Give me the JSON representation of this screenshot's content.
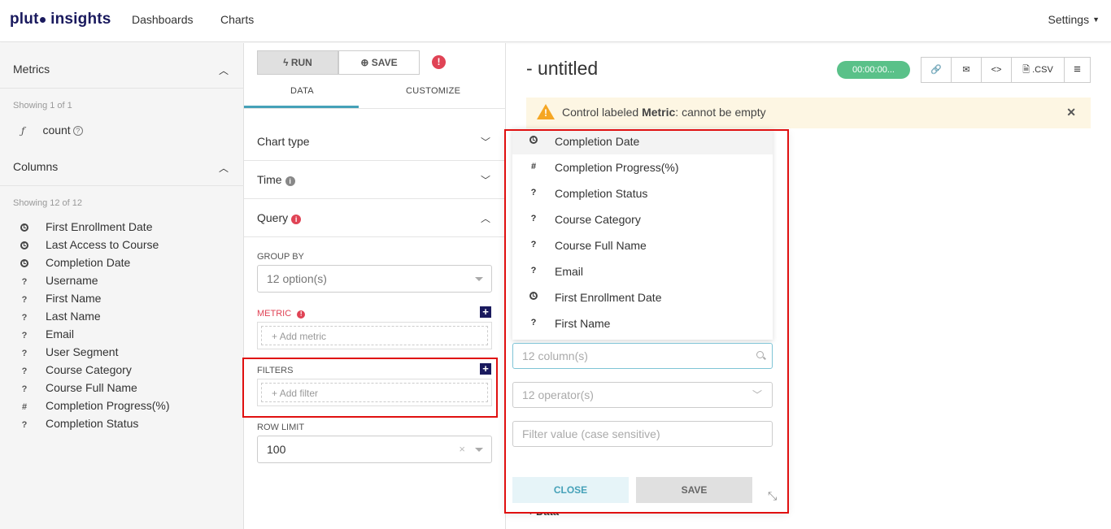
{
  "brand": {
    "name_pre": "plut",
    "name_post": " insights"
  },
  "nav": {
    "dashboards": "Dashboards",
    "charts": "Charts",
    "settings": "Settings"
  },
  "sidebar": {
    "metrics_title": "Metrics",
    "metrics_showing": "Showing 1 of 1",
    "metric_item": "count",
    "columns_title": "Columns",
    "columns_showing": "Showing 12 of 12",
    "columns": [
      {
        "icon": "clock-icon",
        "label": "First Enrollment Date"
      },
      {
        "icon": "clock-icon",
        "label": "Last Access to Course"
      },
      {
        "icon": "clock-icon",
        "label": "Completion Date"
      },
      {
        "icon": "question-icon",
        "label": "Username"
      },
      {
        "icon": "question-icon",
        "label": "First Name"
      },
      {
        "icon": "question-icon",
        "label": "Last Name"
      },
      {
        "icon": "question-icon",
        "label": "Email"
      },
      {
        "icon": "question-icon",
        "label": "User Segment"
      },
      {
        "icon": "question-icon",
        "label": "Course Category"
      },
      {
        "icon": "question-icon",
        "label": "Course Full Name"
      },
      {
        "icon": "hash-icon",
        "label": "Completion Progress(%)"
      },
      {
        "icon": "question-icon",
        "label": "Completion Status"
      }
    ]
  },
  "controls": {
    "run_label": "RUN",
    "save_label": "SAVE",
    "tab_data": "DATA",
    "tab_customize": "CUSTOMIZE",
    "chart_type": "Chart type",
    "time": "Time",
    "query": "Query",
    "group_by_label": "GROUP BY",
    "group_by_value": "12 option(s)",
    "metric_label": "METRIC",
    "add_metric": "Add metric",
    "filters_label": "FILTERS",
    "add_filter": "Add filter",
    "row_limit_label": "ROW LIMIT",
    "row_limit_value": "100"
  },
  "chart_header": {
    "title": "- untitled",
    "timer": "00:00:00...",
    "csv_label": ".CSV"
  },
  "alert": {
    "prefix": "Control labeled ",
    "bold": "Metric",
    "suffix": ": cannot be empty"
  },
  "filter_popover": {
    "options": [
      {
        "icon": "clock-icon",
        "label": "Completion Date"
      },
      {
        "icon": "hash-icon",
        "label": "Completion Progress(%)"
      },
      {
        "icon": "question-icon",
        "label": "Completion Status"
      },
      {
        "icon": "question-icon",
        "label": "Course Category"
      },
      {
        "icon": "question-icon",
        "label": "Course Full Name"
      },
      {
        "icon": "question-icon",
        "label": "Email"
      },
      {
        "icon": "clock-icon",
        "label": "First Enrollment Date"
      },
      {
        "icon": "question-icon",
        "label": "First Name"
      }
    ],
    "column_placeholder": "12 column(s)",
    "operator_placeholder": "12 operator(s)",
    "value_placeholder": "Filter value (case sensitive)",
    "close_label": "CLOSE",
    "save_label": "SAVE"
  },
  "background_fragment": "Data"
}
